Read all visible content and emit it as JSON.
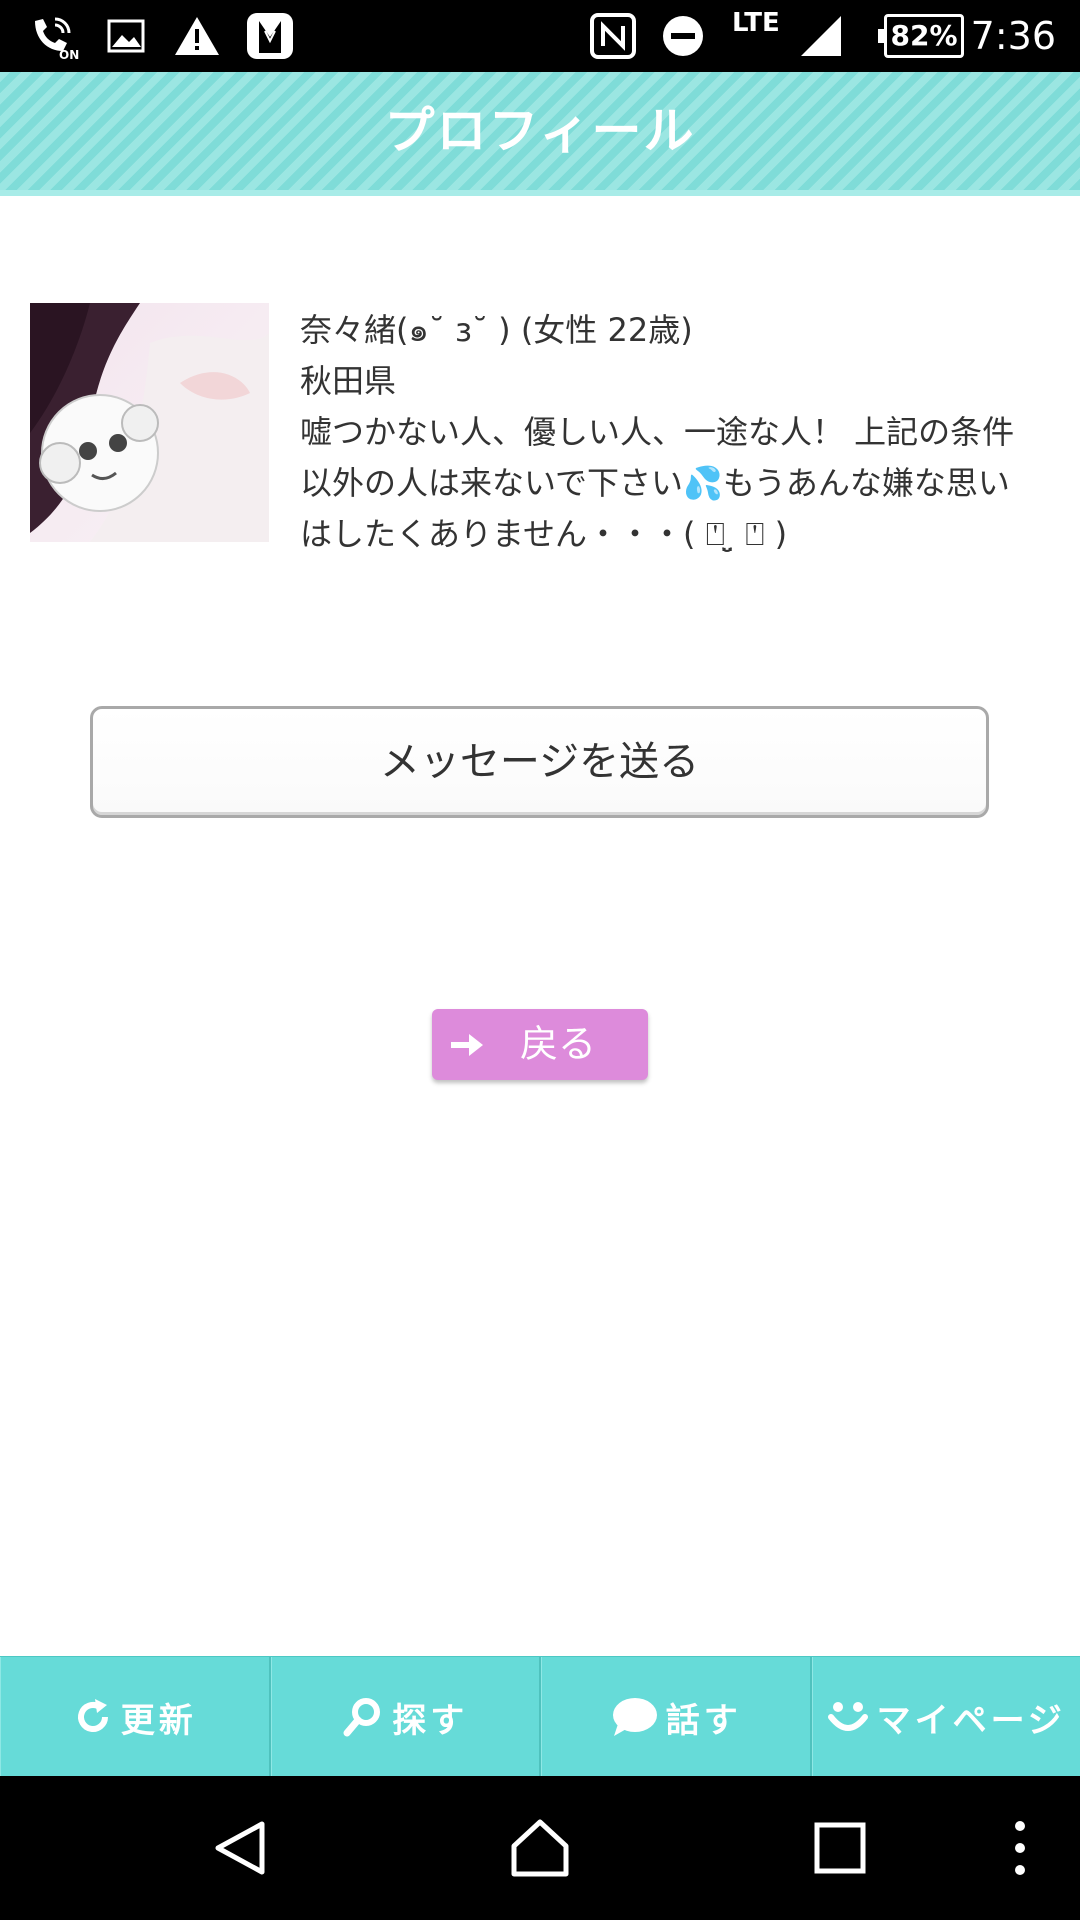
{
  "status_bar": {
    "time": "7:36",
    "battery": "82%",
    "network": "LTE",
    "icons": [
      "wifi-calling-icon",
      "image-icon",
      "warning-icon",
      "app-icon",
      "nfc-icon",
      "do-not-disturb-icon",
      "signal-icon",
      "battery-icon"
    ]
  },
  "header": {
    "title": "プロフィール"
  },
  "profile": {
    "name_line": "奈々緒(๑˘ з˘ ) (女性 22歳)",
    "location": "秋田県",
    "bio": "嘘つかない人、優しい人、一途な人！ 上記の条件以外の人は来ないで下さい💦もうあんな嫌な思いはしたくありません・・・( ⍞ ̤̮ ⍞ )"
  },
  "buttons": {
    "send_message": "メッセージを送る",
    "back": "戻る"
  },
  "tabbar": {
    "items": [
      {
        "label": "更新",
        "icon": "refresh-icon"
      },
      {
        "label": "探す",
        "icon": "search-icon"
      },
      {
        "label": "話す",
        "icon": "chat-bubble-icon"
      },
      {
        "label": "マイページ",
        "icon": "smiley-icon"
      }
    ]
  },
  "navbar": {
    "icons": [
      "back-triangle-icon",
      "home-icon",
      "recents-icon",
      "more-vert-icon"
    ]
  },
  "colors": {
    "header": "#7fdcd8",
    "tabbar": "#66dbd8",
    "back_button": "#dd8bdb"
  }
}
